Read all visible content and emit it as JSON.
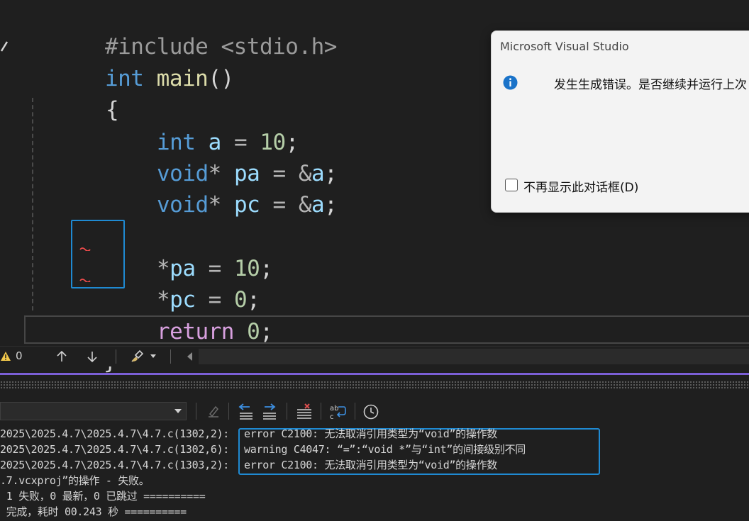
{
  "editor": {
    "lines": [
      [
        "#include <stdio.h>"
      ],
      [
        "int",
        " ",
        "main",
        "()"
      ],
      [
        "{"
      ],
      [
        "int",
        " ",
        "a",
        " = ",
        "10",
        ";"
      ],
      [
        "void",
        "*",
        " ",
        "pa",
        " = ",
        "&",
        "a",
        ";"
      ],
      [
        "void",
        "*",
        " ",
        "pc",
        " = ",
        "&",
        "a",
        ";"
      ],
      [
        "*",
        "pa",
        " = ",
        "10",
        ";"
      ],
      [
        "*",
        "pc",
        " = ",
        "0",
        ";"
      ],
      [
        "return",
        " ",
        "0",
        ";"
      ],
      [
        "}"
      ]
    ]
  },
  "status": {
    "warning_count": "0"
  },
  "output": {
    "lines": [
      "2025\\2025.4.7\\2025.4.7\\4.7.c(1302,2):",
      "2025\\2025.4.7\\2025.4.7\\4.7.c(1302,6):",
      "2025\\2025.4.7\\2025.4.7\\4.7.c(1303,2):",
      ".7.vcxproj”的操作 - 失败。",
      " 1 失败，0 最新，0 已跳过 ==========",
      " 完成，耗时 00.243 秒 =========="
    ],
    "messages": [
      "error C2100: 无法取消引用类型为“void”的操作数",
      "warning C4047: “=”:“void *”与“int”的间接级别不同",
      "error C2100: 无法取消引用类型为“void”的操作数"
    ]
  },
  "dialog": {
    "title": "Microsoft Visual Studio",
    "message": "发生生成错误。是否继续并运行上次",
    "checkbox_label": "不再显示此对话框(D)",
    "checkbox_checked": false
  },
  "colors": {
    "keyword": "#569cd6",
    "function": "#dcdcaa",
    "variable": "#9cdcfe",
    "number": "#b5cea8",
    "control": "#d8a0df",
    "selection_border": "#1f8ad2",
    "splitter": "#7b5fd6"
  },
  "icons": [
    "warning-icon",
    "arrow-up-icon",
    "arrow-down-icon",
    "brush-icon",
    "info-icon",
    "clock-icon",
    "word-wrap-icon",
    "clear-all-icon"
  ]
}
